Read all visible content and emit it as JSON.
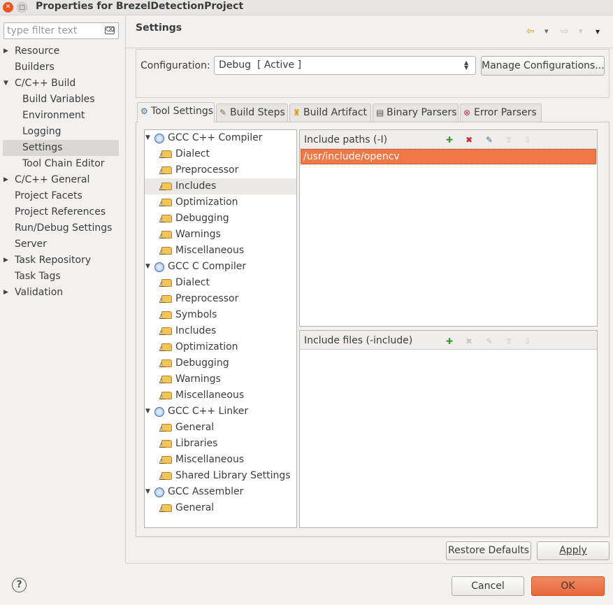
{
  "window": {
    "title": "Properties for BrezelDetectionProject",
    "close_glyph": "✕",
    "max_glyph": "□"
  },
  "filter": {
    "placeholder": "type filter text",
    "clear_glyph": "⌫"
  },
  "nav": {
    "items": [
      {
        "label": "Resource",
        "expandable": true
      },
      {
        "label": "Builders",
        "expandable": false
      },
      {
        "label": "C/C++ Build",
        "expandable": true,
        "expanded": true
      },
      {
        "label": "Build Variables",
        "child": true
      },
      {
        "label": "Environment",
        "child": true
      },
      {
        "label": "Logging",
        "child": true
      },
      {
        "label": "Settings",
        "child": true,
        "selected": true
      },
      {
        "label": "Tool Chain Editor",
        "child": true
      },
      {
        "label": "C/C++ General",
        "expandable": true
      },
      {
        "label": "Project Facets",
        "expandable": false
      },
      {
        "label": "Project References",
        "expandable": false
      },
      {
        "label": "Run/Debug Settings",
        "expandable": false
      },
      {
        "label": "Server",
        "expandable": false
      },
      {
        "label": "Task Repository",
        "expandable": true
      },
      {
        "label": "Task Tags",
        "expandable": false
      },
      {
        "label": "Validation",
        "expandable": true
      }
    ]
  },
  "header": {
    "title": "Settings",
    "back_glyph": "⇦",
    "forward_glyph": "⇨",
    "dropdown_glyph": "▾",
    "menu_glyph": "▾"
  },
  "config": {
    "label": "Configuration:",
    "value": "Debug  [ Active ]",
    "manage_label": "Manage Configurations..."
  },
  "tabs": [
    {
      "label": "Tool Settings",
      "icon": "tool-settings-icon",
      "glyph": "⚙",
      "active": true
    },
    {
      "label": "Build Steps",
      "icon": "build-steps-icon",
      "glyph": "✎"
    },
    {
      "label": "Build Artifact",
      "icon": "build-artifact-icon",
      "glyph": "♜"
    },
    {
      "label": "Binary Parsers",
      "icon": "binary-parsers-icon",
      "glyph": "▤"
    },
    {
      "label": "Error Parsers",
      "icon": "error-parsers-icon",
      "glyph": "⊗"
    }
  ],
  "tree": {
    "tools": [
      {
        "label": "GCC C++ Compiler",
        "options": [
          "Dialect",
          "Preprocessor",
          "Includes",
          "Optimization",
          "Debugging",
          "Warnings",
          "Miscellaneous"
        ],
        "selected": "Includes"
      },
      {
        "label": "GCC C Compiler",
        "options": [
          "Dialect",
          "Preprocessor",
          "Symbols",
          "Includes",
          "Optimization",
          "Debugging",
          "Warnings",
          "Miscellaneous"
        ]
      },
      {
        "label": "GCC C++ Linker",
        "options": [
          "General",
          "Libraries",
          "Miscellaneous",
          "Shared Library Settings"
        ]
      },
      {
        "label": "GCC Assembler",
        "options": [
          "General"
        ]
      }
    ],
    "expand_glyph": "▼"
  },
  "include_paths": {
    "title": "Include paths (-I)",
    "items": [
      "/usr/include/opencv"
    ],
    "toolbar": [
      {
        "name": "add-icon",
        "glyph": "✚",
        "color": "#3a9a3a",
        "enabled": true
      },
      {
        "name": "delete-icon",
        "glyph": "✖",
        "color": "#cc2a2a",
        "enabled": true
      },
      {
        "name": "edit-icon",
        "glyph": "✎",
        "color": "#4a6b8a",
        "enabled": true
      },
      {
        "name": "move-up-icon",
        "glyph": "⇧",
        "color": "#c9c8c5",
        "enabled": false
      },
      {
        "name": "move-down-icon",
        "glyph": "⇩",
        "color": "#c9c8c5",
        "enabled": false
      }
    ]
  },
  "include_files": {
    "title": "Include files (-include)",
    "items": [],
    "toolbar": [
      {
        "name": "add-icon",
        "glyph": "✚",
        "color": "#3a9a3a",
        "enabled": true
      },
      {
        "name": "delete-icon",
        "glyph": "✖",
        "color": "#c9c8c5",
        "enabled": false
      },
      {
        "name": "edit-icon",
        "glyph": "✎",
        "color": "#c9c8c5",
        "enabled": false
      },
      {
        "name": "move-up-icon",
        "glyph": "⇧",
        "color": "#c9c8c5",
        "enabled": false
      },
      {
        "name": "move-down-icon",
        "glyph": "⇩",
        "color": "#c9c8c5",
        "enabled": false
      }
    ]
  },
  "buttons": {
    "restore": "Restore Defaults",
    "apply": "Apply",
    "cancel": "Cancel",
    "ok": "OK",
    "help_glyph": "?"
  },
  "colors": {
    "selection": "#f07746",
    "accent": "#e95420"
  }
}
